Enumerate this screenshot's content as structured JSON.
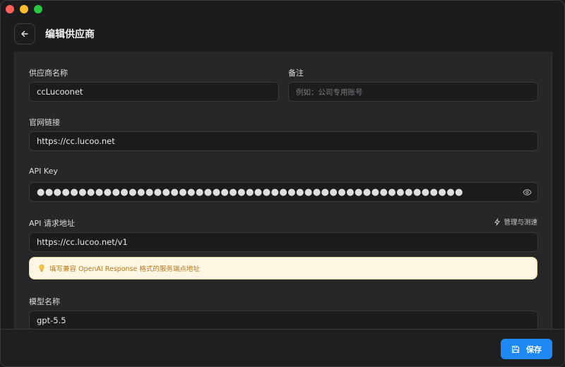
{
  "header": {
    "title": "编辑供应商"
  },
  "form": {
    "name": {
      "label": "供应商名称",
      "value": "ccLucoonet"
    },
    "note": {
      "label": "备注",
      "placeholder": "例如：公司专用账号"
    },
    "website": {
      "label": "官网链接",
      "value": "https://cc.lucoo.net"
    },
    "api_key": {
      "label": "API Key",
      "masked_value": "●●●●●●●●●●●●●●●●●●●●●●●●●●●●●●●●●●●●●●●●●●●●●●●●●●●"
    },
    "endpoint": {
      "label": "API 请求地址",
      "manage_label": "管理与测速",
      "value": "https://cc.lucoo.net/v1",
      "tip": "填写兼容 OpenAI Response 格式的服务端点地址"
    },
    "model": {
      "label": "模型名称",
      "value": "gpt-5.5"
    }
  },
  "footer": {
    "save_label": "保存"
  },
  "colors": {
    "accent": "#1e88f5",
    "tip_bg": "#fdf6e3",
    "tip_text": "#b7791f"
  }
}
